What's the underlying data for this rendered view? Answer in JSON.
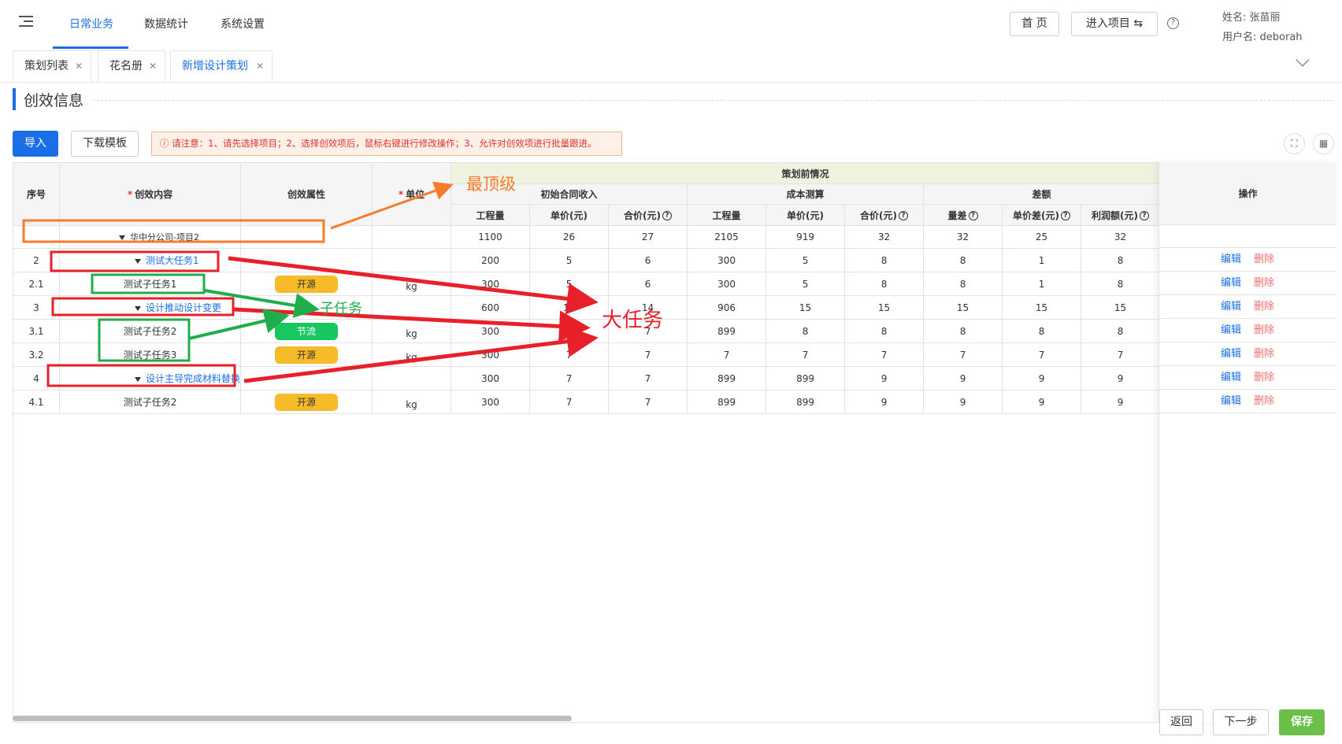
{
  "nav": {
    "items": [
      "日常业务",
      "数据统计",
      "系统设置"
    ],
    "home_label": "首 页",
    "enter_project_label": "进入项目 ⇆",
    "help_glyph": "?",
    "user_name_line": "姓名: 张苗丽",
    "user_account_line": "用户名: deborah"
  },
  "tabs": [
    {
      "label": "策划列表"
    },
    {
      "label": "花名册"
    },
    {
      "label": "新增设计策划"
    }
  ],
  "section": {
    "title": "创效信息"
  },
  "toolbar": {
    "import_label": "导入",
    "template_label": "下载模板",
    "notice": "ⓘ 请注意：1、请先选择项目；2、选择创效项后，鼠标右键进行修改操作；3、允许对创效项进行批量跟进。"
  },
  "table": {
    "headers": {
      "seq": "序号",
      "content": "创效内容",
      "attr": "创效属性",
      "unit": "单位",
      "pre_group": "策划前情况",
      "g1": "初始合同收入",
      "g2": "成本测算",
      "g3": "差额",
      "cols": [
        "工程量",
        "单价(元)",
        "合价(元)",
        "工程量",
        "单价(元)",
        "合价(元)",
        "量差",
        "单价差(元)",
        "利润额(元)"
      ],
      "ops": "操作"
    },
    "top_row": {
      "content": "华中分公司-项目2",
      "values": [
        "1100",
        "26",
        "27",
        "2105",
        "919",
        "32",
        "32",
        "25",
        "32"
      ]
    },
    "rows": [
      {
        "seq": "2",
        "content": "测试大任务1",
        "parent": true,
        "attr": "",
        "unit": "",
        "values": [
          "200",
          "5",
          "6",
          "300",
          "5",
          "8",
          "8",
          "1",
          "8"
        ]
      },
      {
        "seq": "2.1",
        "content": "测试子任务1",
        "parent": false,
        "attr": "开源",
        "unit": "kg",
        "values": [
          "300",
          "5",
          "6",
          "300",
          "5",
          "8",
          "8",
          "1",
          "8"
        ]
      },
      {
        "seq": "3",
        "content": "设计推动设计变更",
        "parent": true,
        "attr": "",
        "unit": "",
        "values": [
          "600",
          "14",
          "14",
          "906",
          "15",
          "15",
          "15",
          "15",
          "15"
        ]
      },
      {
        "seq": "3.1",
        "content": "测试子任务2",
        "parent": false,
        "attr": "节流",
        "unit": "kg",
        "values": [
          "300",
          "7",
          "7",
          "899",
          "8",
          "8",
          "8",
          "8",
          "8"
        ]
      },
      {
        "seq": "3.2",
        "content": "测试子任务3",
        "parent": false,
        "attr": "开源",
        "unit": "kg",
        "values": [
          "300",
          "7",
          "7",
          "7",
          "7",
          "7",
          "7",
          "7",
          "7"
        ]
      },
      {
        "seq": "4",
        "content": "设计主导完成材料替换",
        "parent": true,
        "attr": "",
        "unit": "",
        "values": [
          "300",
          "7",
          "7",
          "899",
          "899",
          "9",
          "9",
          "9",
          "9"
        ]
      },
      {
        "seq": "4.1",
        "content": "测试子任务2",
        "parent": false,
        "attr": "开源",
        "unit": "kg",
        "values": [
          "300",
          "7",
          "7",
          "899",
          "899",
          "9",
          "9",
          "9",
          "9"
        ]
      }
    ],
    "edit_label": "编辑",
    "delete_label": "删除"
  },
  "footer": {
    "back_label": "返回",
    "next_label": "下一步",
    "save_label": "保存"
  },
  "annotations": {
    "top_level": "最顶级",
    "sub_task": "子任务",
    "big_task": "大任务"
  },
  "colors": {
    "accent": "#1a6fe8",
    "orange_pill": "#f7bb2a",
    "green_pill": "#19c760",
    "save": "#6cc04a",
    "anno_red": "#e8202a",
    "anno_green": "#1fae4a",
    "anno_orange": "#f97a2a"
  }
}
